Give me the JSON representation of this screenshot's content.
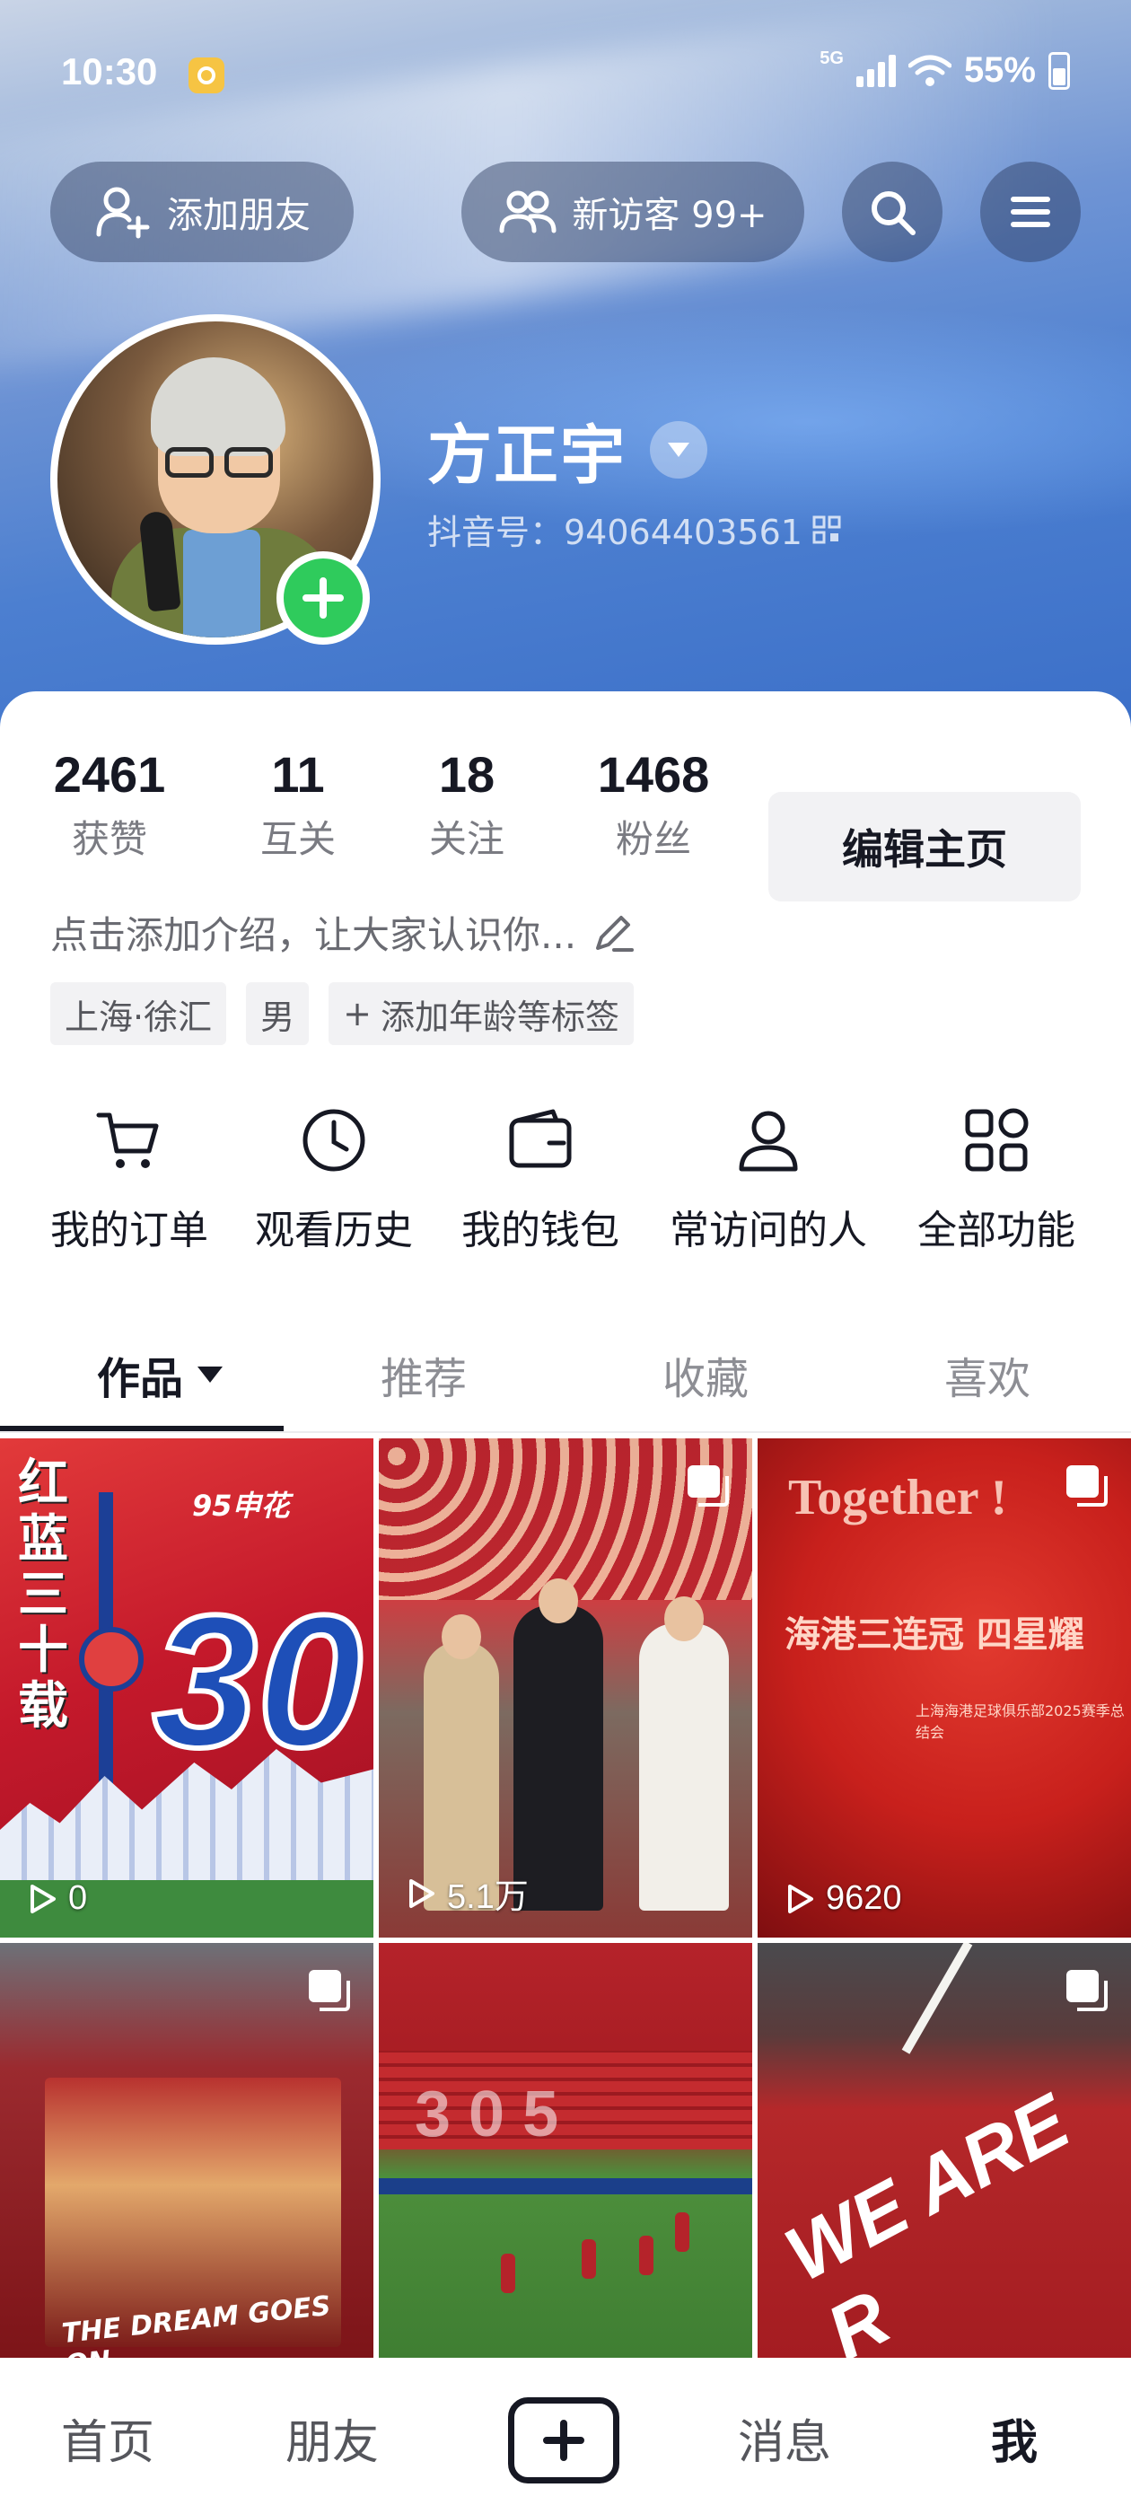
{
  "status_bar": {
    "time": "10:30",
    "network": "5G",
    "battery": "55%"
  },
  "header": {
    "add_friend_label": "添加朋友",
    "visitors_label": "新访客 99+"
  },
  "profile": {
    "nickname": "方正宇",
    "douyin_id": "抖音号：94064403561",
    "stats": [
      {
        "value": "2461",
        "label": "获赞"
      },
      {
        "value": "11",
        "label": "互关"
      },
      {
        "value": "18",
        "label": "关注"
      },
      {
        "value": "1468",
        "label": "粉丝"
      }
    ],
    "edit_button": "编辑主页",
    "bio_placeholder": "点击添加介绍，让大家认识你...",
    "tags": [
      "上海·徐汇",
      "男",
      "添加年龄等标签"
    ]
  },
  "features": [
    {
      "label": "我的订单",
      "icon": "cart-icon"
    },
    {
      "label": "观看历史",
      "icon": "clock-icon"
    },
    {
      "label": "我的钱包",
      "icon": "wallet-icon"
    },
    {
      "label": "常访问的人",
      "icon": "person-icon"
    },
    {
      "label": "全部功能",
      "icon": "grid-icon"
    }
  ],
  "tabs": [
    {
      "label": "作品",
      "active": true
    },
    {
      "label": "推荐"
    },
    {
      "label": "收藏"
    },
    {
      "label": "喜欢"
    }
  ],
  "videos": [
    {
      "views": "0",
      "overlay": {
        "vertical_text": "红蓝三十载",
        "top_text": "95申花",
        "number": "30"
      }
    },
    {
      "views": "5.1万"
    },
    {
      "views": "9620",
      "overlay": {
        "title": "Together !",
        "banner": "海港三连冠 四星耀",
        "sub": "上海海港足球俱乐部2025赛季总结会"
      }
    },
    {
      "overlay": {
        "text": "THE DREAM GOES ON"
      }
    },
    {
      "overlay": {
        "text": "305"
      }
    },
    {
      "overlay": {
        "text": "WE ARE R"
      }
    }
  ],
  "bottom_nav": [
    "首页",
    "朋友",
    "消息",
    "我"
  ],
  "colors": {
    "accent_green": "#2fcb5c",
    "text_primary": "#161823",
    "text_secondary": "#7a7b82"
  }
}
